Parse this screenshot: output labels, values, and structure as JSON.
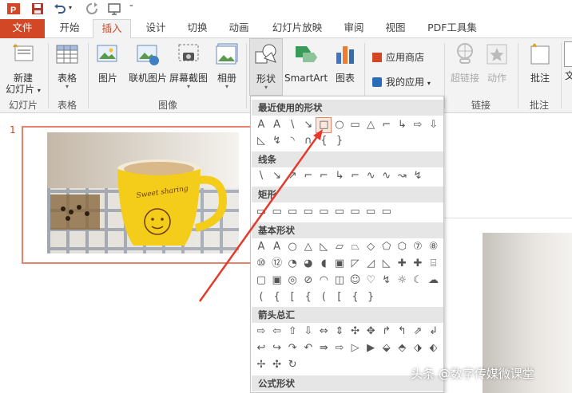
{
  "tabs": {
    "file": "文件",
    "items": [
      "开始",
      "插入",
      "设计",
      "切换",
      "动画",
      "幻灯片放映",
      "审阅",
      "视图",
      "PDF工具集"
    ],
    "active_index": 1
  },
  "ribbon": {
    "new_slide": "新建",
    "new_slide_2": "幻灯片",
    "table": "表格",
    "picture": "图片",
    "online_picture": "联机图片",
    "screenshot": "屏幕截图",
    "album": "相册",
    "shapes": "形状",
    "smartart": "SmartArt",
    "chart": "图表",
    "app_store": "应用商店",
    "my_apps": "我的应用",
    "hyperlink": "超链接",
    "action": "动作",
    "comment": "批注",
    "text_partial": "文",
    "groups": {
      "slides": "幻灯片",
      "tables": "表格",
      "images": "图像",
      "links": "链接",
      "comments": "批注"
    }
  },
  "slide": {
    "number": "1",
    "cup_text": "Sweet sharing"
  },
  "shapes_panel": {
    "categories": [
      "最近使用的形状",
      "线条",
      "矩形",
      "基本形状",
      "箭头总汇",
      "公式形状"
    ],
    "recent_row1": [
      "A",
      "A",
      "\\",
      "↘",
      "□",
      "○",
      "▭",
      "△",
      "⌐",
      "↳",
      "⇨",
      "⇩"
    ],
    "recent_row2": [
      "◺",
      "↯",
      "◝",
      "∩",
      "{",
      "}"
    ],
    "lines_row": [
      "\\",
      "↘",
      "↗",
      "⌐",
      "⌐",
      "↳",
      "⌐",
      "∿",
      "∿",
      "↝",
      "↯"
    ],
    "rect_row": [
      "▭",
      "▭",
      "▭",
      "▭",
      "▭",
      "▭",
      "▭",
      "▭",
      "▭"
    ],
    "basic_row1": [
      "A",
      "A",
      "○",
      "△",
      "◺",
      "▱",
      "⏢",
      "◇",
      "⬠",
      "⬡",
      "⑦",
      "⑧"
    ],
    "basic_row2": [
      "⑩",
      "⑫",
      "◔",
      "◕",
      "◖",
      "▣",
      "◸",
      "◿",
      "◺",
      "✚",
      "✚",
      "⌸"
    ],
    "basic_row3": [
      "▢",
      "▣",
      "◎",
      "⊘",
      "◠",
      "◫",
      "☺",
      "♡",
      "↯",
      "☼",
      "☾",
      "☁"
    ],
    "basic_row4": [
      "(",
      "{",
      "[",
      "{",
      "(",
      "[",
      "{",
      "}"
    ],
    "arrow_row1": [
      "⇨",
      "⇦",
      "⇧",
      "⇩",
      "⇔",
      "⇕",
      "✣",
      "✥",
      "↱",
      "↰",
      "⇗",
      "↲"
    ],
    "arrow_row2": [
      "↩",
      "↪",
      "↷",
      "↶",
      "⇛",
      "⇨",
      "▷",
      "▶",
      "⬙",
      "⬘",
      "⬗",
      "⬖"
    ],
    "arrow_row3": [
      "✢",
      "✣",
      "↻"
    ]
  },
  "watermark": "头条 @数字传媒微课堂",
  "colors": {
    "accent": "#d24726",
    "panel_bg": "#ffffff",
    "cat_bg": "#e6e6e6",
    "arrow": "#e5392b"
  }
}
